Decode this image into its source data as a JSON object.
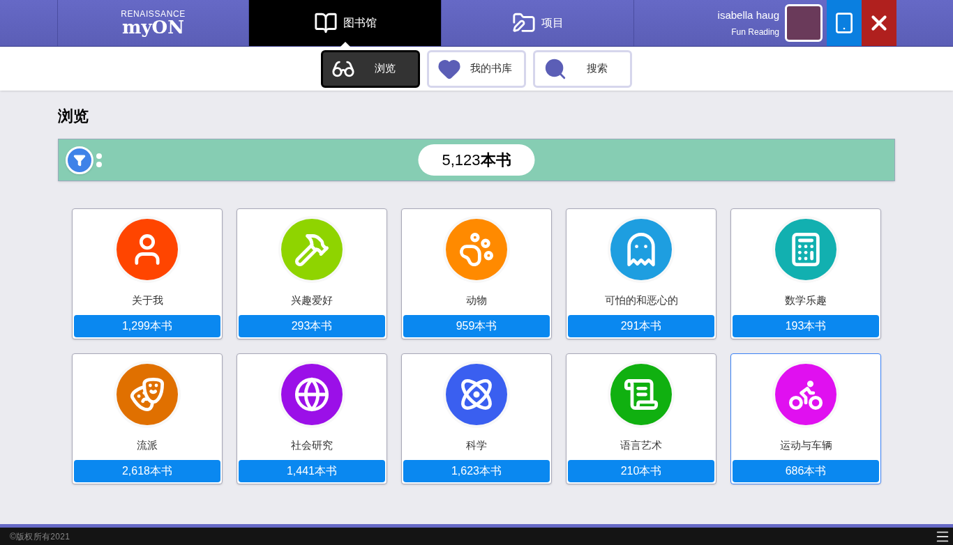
{
  "header": {
    "logo_top": "RENAISSANCE",
    "logo_bottom": "myON",
    "tabs": [
      {
        "label": "图书馆",
        "selected": true
      },
      {
        "label": "项目",
        "selected": false
      }
    ],
    "user": {
      "name": "isabella haug",
      "subtitle": "Fun Reading"
    }
  },
  "subnav": [
    {
      "label": "浏览",
      "selected": true
    },
    {
      "label": "我的书库",
      "selected": false
    },
    {
      "label": "搜索",
      "selected": false
    }
  ],
  "page_title": "浏览",
  "filter_bar": {
    "total": "5,123**本书**"
  },
  "categories": [
    {
      "name": "关于我",
      "count": "1,299本书",
      "color": "#ff4500",
      "selected": false
    },
    {
      "name": "兴趣爱好",
      "count": "293本书",
      "color": "#8fd400",
      "selected": false
    },
    {
      "name": "动物",
      "count": "959本书",
      "color": "#ff8a00",
      "selected": false
    },
    {
      "name": "可怕的和恶心的",
      "count": "291本书",
      "color": "#1e9ee0",
      "selected": false
    },
    {
      "name": "数学乐趣",
      "count": "193本书",
      "color": "#12b0b0",
      "selected": false
    },
    {
      "name": "流派",
      "count": "2,618本书",
      "color": "#e07000",
      "selected": false
    },
    {
      "name": "社会研究",
      "count": "1,441本书",
      "color": "#9b10e8",
      "selected": false
    },
    {
      "name": "科学",
      "count": "1,623本书",
      "color": "#3a5ff0",
      "selected": false
    },
    {
      "name": "语言艺术",
      "count": "210本书",
      "color": "#10b010",
      "selected": false
    },
    {
      "name": "运动与车辆",
      "count": "686本书",
      "color": "#e010f0",
      "selected": true
    }
  ],
  "footer": {
    "copyright": "©版权所有2021"
  }
}
